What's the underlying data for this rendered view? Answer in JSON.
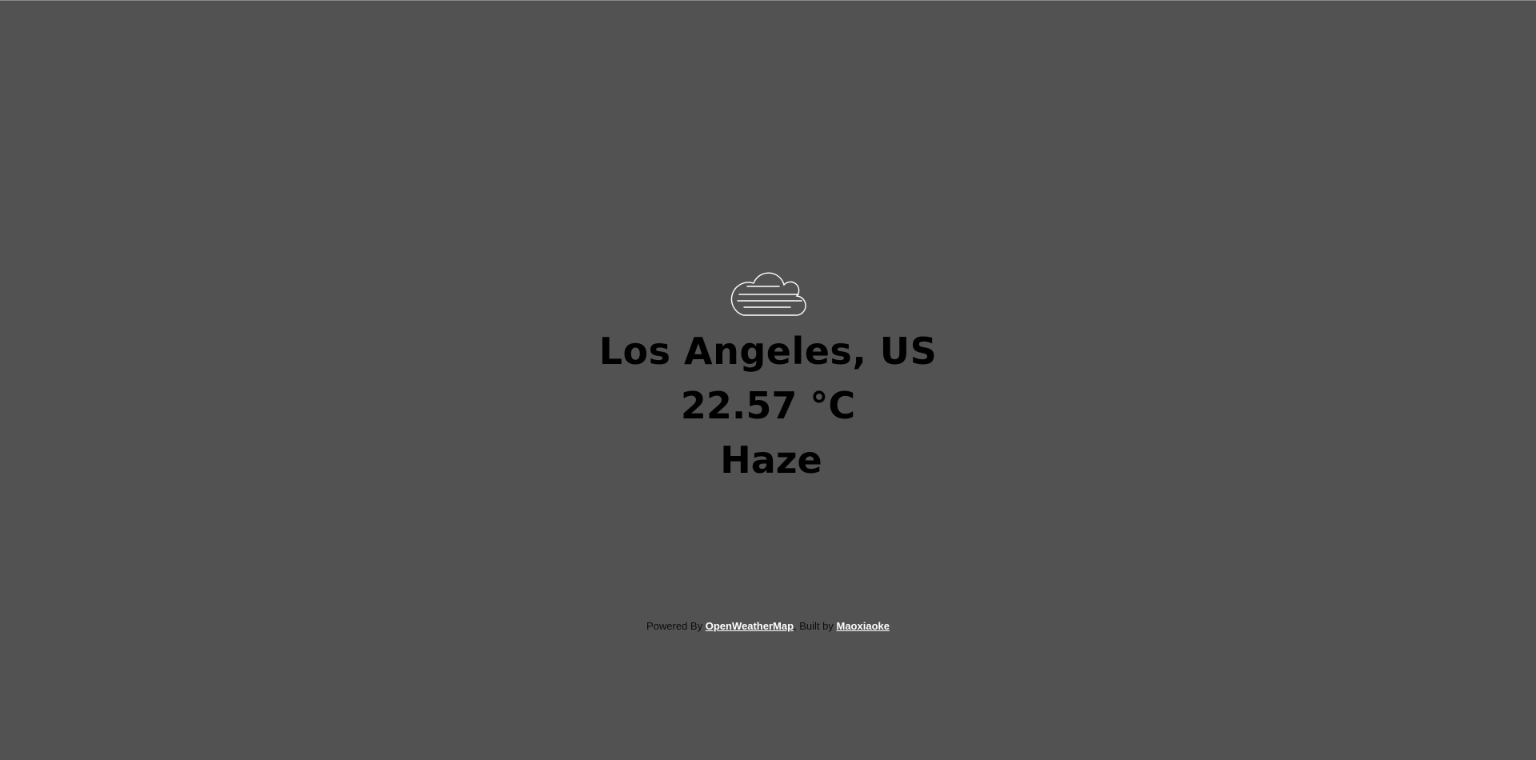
{
  "weather": {
    "icon": "haze-cloud-icon",
    "city": "Los Angeles, US",
    "temperature": "22.57 °C",
    "description": "Haze"
  },
  "footer": {
    "powered_by": "Powered By",
    "powered_link": "OpenWeatherMap",
    "built_by": ", Built by",
    "author_link": "Maoxiaoke"
  },
  "colors": {
    "background": "#525252",
    "text": "#000000",
    "link": "#ffffff"
  }
}
